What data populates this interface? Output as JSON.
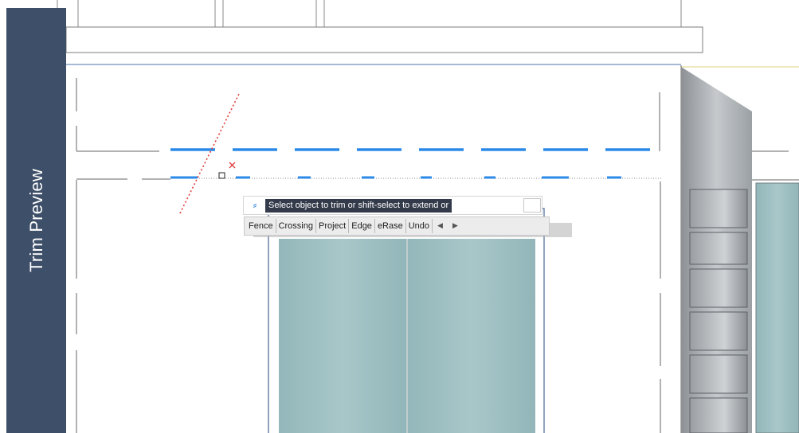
{
  "side_panel": {
    "label": "Trim Preview",
    "bg": "#3e4f69"
  },
  "command_prompt": {
    "text": "Select object to trim or shift-select to extend or",
    "icon": "trim-command-icon",
    "input_value": ""
  },
  "options": [
    "Fence",
    "Crossing",
    "Project",
    "Edge",
    "eRase",
    "Undo"
  ],
  "nav": {
    "prev_icon": "◀",
    "next_icon": "▶"
  },
  "colors": {
    "selected_dash": "#2b8ae8",
    "trim_path": "#e23b3b",
    "glass": "#9ec0c2",
    "drawing_line": "#6b6b6b"
  }
}
